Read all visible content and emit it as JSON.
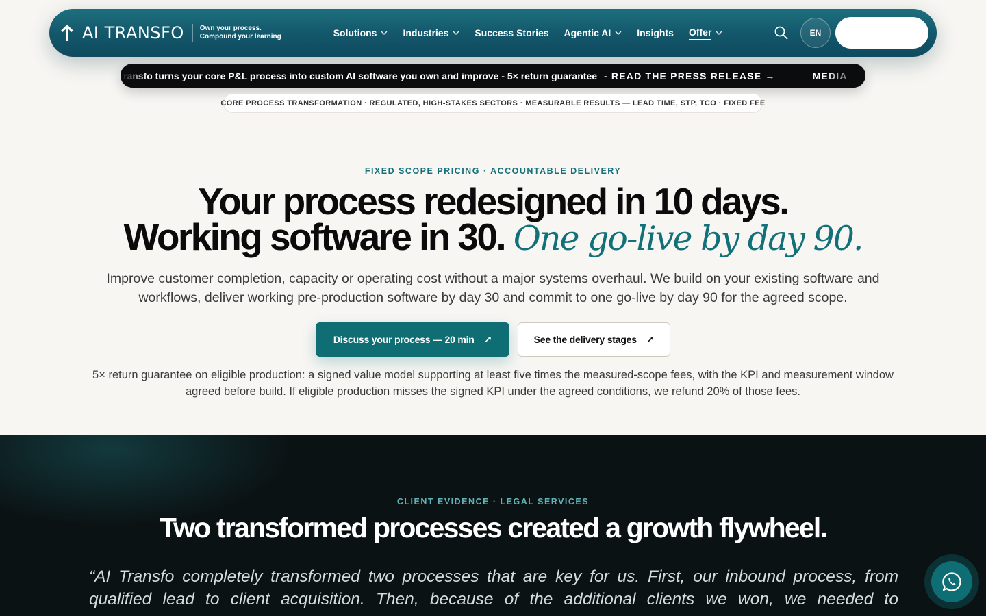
{
  "nav": {
    "brand": "AI TRANSFO",
    "tagline_line1": "Own your process.",
    "tagline_line2": "Compound your learning",
    "items": [
      {
        "label": "Solutions",
        "dropdown": true
      },
      {
        "label": "Industries",
        "dropdown": true
      },
      {
        "label": "Success Stories",
        "dropdown": false
      },
      {
        "label": "Agentic AI",
        "dropdown": true
      },
      {
        "label": "Insights",
        "dropdown": false
      },
      {
        "label": "Offer",
        "dropdown": true
      }
    ],
    "lang": "EN",
    "icons": {
      "logo": "arrow-up-icon",
      "search": "search-icon",
      "chevron": "chevron-down-icon"
    }
  },
  "ticker": {
    "text": "ransfo turns your core P&L process into custom AI software you own and improve - 5× return guarantee",
    "link": "- READ THE PRESS RELEASE →",
    "next": "MEDIA"
  },
  "subbar": "CORE PROCESS TRANSFORMATION · REGULATED, HIGH-STAKES SECTORS · MEASURABLE RESULTS — LEAD TIME, STP, TCO · FIXED FEE",
  "hero": {
    "eyebrow": "FIXED SCOPE PRICING · ACCOUNTABLE DELIVERY",
    "title_line1": "Your process redesigned in 10 days.",
    "title_line2": "Working software in 30.",
    "title_italic": "One go-live by day 90.",
    "subtitle": "Improve customer completion, capacity or operating cost without a major systems overhaul. We build on your existing software and workflows, deliver working pre-production software by day 30 and commit to one go-live by day 90 for the agreed scope.",
    "primary_cta": "Discuss your process — 20 min",
    "secondary_cta": "See the delivery stages",
    "cta_arrow": "↗",
    "guarantee": "5× return guarantee on eligible production: a signed value model supporting at least five times the measured-scope fees, with the KPI and measurement window agreed before build. If eligible production misses the signed KPI under the agreed conditions, we refund 20% of those fees."
  },
  "evidence": {
    "eyebrow": "CLIENT EVIDENCE · LEGAL SERVICES",
    "title": "Two transformed processes created a growth flywheel.",
    "quote": "“AI Transfo completely transformed two processes that are key for us. First, our inbound process, from qualified lead to client acquisition. Then, because of the additional clients we won, we needed to"
  },
  "colors": {
    "accent": "#0e6e74",
    "nav_bg": "#13566a",
    "dark_bg": "#0b1214",
    "page_bg": "#f7f6f3"
  },
  "chat": {
    "icon": "whatsapp-icon"
  }
}
